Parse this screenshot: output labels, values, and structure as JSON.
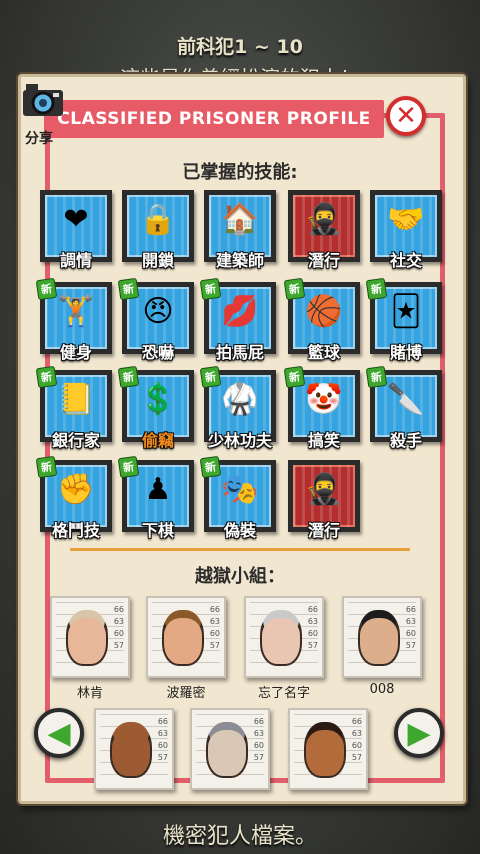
{
  "background": {
    "title": "前科犯1 ~ 10",
    "subtitle": "這些是你曾經扮演的犯人！",
    "bottom_text": "機密犯人檔案。"
  },
  "header": {
    "title": "CLASSIFIED PRISONER PROFILE",
    "share_label": "分享",
    "close_icon": "close-icon"
  },
  "skills_section": {
    "title": "已掌握的技能:",
    "new_badge": "新",
    "items": [
      {
        "label": "調情",
        "icon": "heart-love-icon",
        "glyph": "❤",
        "new": false,
        "label_color": "white"
      },
      {
        "label": "開鎖",
        "icon": "padlock-icon",
        "glyph": "🔒",
        "new": false,
        "label_color": "white"
      },
      {
        "label": "建築師",
        "icon": "house-pencil-icon",
        "glyph": "🏠",
        "new": false,
        "label_color": "white"
      },
      {
        "label": "潛行",
        "icon": "ninja-icon",
        "glyph": "🥷",
        "new": false,
        "label_color": "white"
      },
      {
        "label": "社交",
        "icon": "handshake-icon",
        "glyph": "🤝",
        "new": false,
        "label_color": "white"
      },
      {
        "label": "健身",
        "icon": "dumbbell-icon",
        "glyph": "🏋",
        "new": true,
        "label_color": "white"
      },
      {
        "label": "恐嚇",
        "icon": "angry-face-icon",
        "glyph": "😠",
        "new": true,
        "label_color": "white"
      },
      {
        "label": "拍馬屁",
        "icon": "butt-kiss-icon",
        "glyph": "💋",
        "new": true,
        "label_color": "white"
      },
      {
        "label": "籃球",
        "icon": "basketball-icon",
        "glyph": "🏀",
        "new": true,
        "label_color": "white"
      },
      {
        "label": "賭博",
        "icon": "cards-money-icon",
        "glyph": "🃏",
        "new": true,
        "label_color": "white"
      },
      {
        "label": "銀行家",
        "icon": "ledger-pen-icon",
        "glyph": "📒",
        "new": true,
        "label_color": "white"
      },
      {
        "label": "偷竊",
        "icon": "stealing-hand-icon",
        "glyph": "💲",
        "new": true,
        "label_color": "orange"
      },
      {
        "label": "少林功夫",
        "icon": "kung-fu-icon",
        "glyph": "🥋",
        "new": true,
        "label_color": "white"
      },
      {
        "label": "搞笑",
        "icon": "clown-icon",
        "glyph": "🤡",
        "new": true,
        "label_color": "white"
      },
      {
        "label": "殺手",
        "icon": "knife-hand-icon",
        "glyph": "🔪",
        "new": true,
        "label_color": "white"
      },
      {
        "label": "格鬥技",
        "icon": "fist-icon",
        "glyph": "✊",
        "new": true,
        "label_color": "white"
      },
      {
        "label": "下棋",
        "icon": "chessboard-icon",
        "glyph": "♟",
        "new": true,
        "label_color": "white"
      },
      {
        "label": "偽裝",
        "icon": "disguise-icon",
        "glyph": "🎭",
        "new": true,
        "label_color": "white"
      },
      {
        "label": "潛行",
        "icon": "ninja-icon",
        "glyph": "🥷",
        "new": false,
        "label_color": "white"
      }
    ]
  },
  "crew_section": {
    "title": "越獄小組：",
    "members": [
      {
        "name": "林肯",
        "skin": "#e7b799",
        "hair": "#d8c4a8"
      },
      {
        "name": "波羅密",
        "skin": "#e3a884",
        "hair": "#8a5a2b"
      },
      {
        "name": "忘了名字",
        "skin": "#e9c6b2",
        "hair": "#c9c9c9"
      },
      {
        "name": "008",
        "skin": "#dcae8c",
        "hair": "#1d1d1d"
      },
      {
        "name": "",
        "skin": "#9c5b32",
        "hair": "#9c5b32"
      },
      {
        "name": "",
        "skin": "#d9c8b6",
        "hair": "#8c8c94"
      },
      {
        "name": "",
        "skin": "#b36b3c",
        "hair": "#2a1a12"
      }
    ],
    "mugshot_numbers": [
      "66",
      "63",
      "60",
      "57"
    ]
  },
  "nav": {
    "prev_icon": "arrow-left-icon",
    "next_icon": "arrow-right-icon"
  },
  "colors": {
    "tile_blue": "#35a3df",
    "tile_red": "#b52e2e",
    "header_red": "#e75b66",
    "new_green": "#3da82d",
    "accent_orange": "#e8a13a"
  }
}
